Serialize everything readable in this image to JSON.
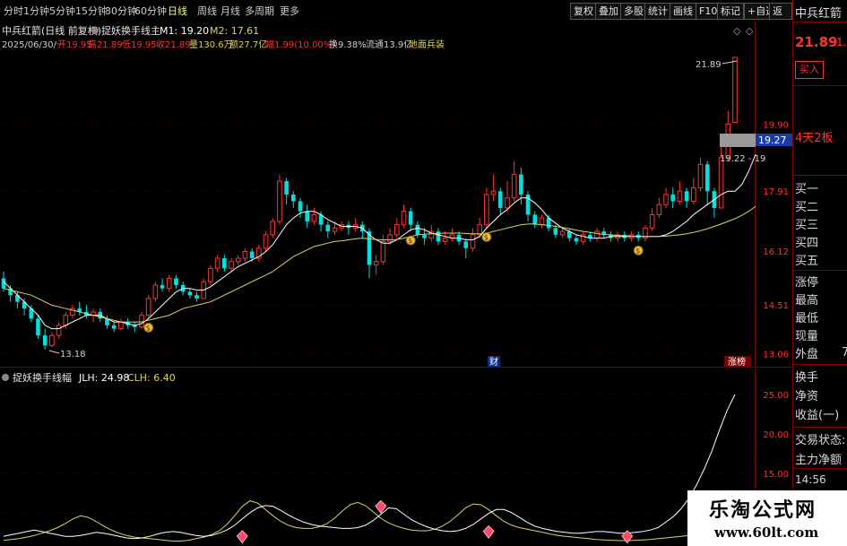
{
  "toolbar": {
    "periods": [
      "分时",
      "1分钟",
      "5分钟",
      "15分钟",
      "30分钟",
      "60分钟",
      "日线",
      "周线",
      "月线",
      "多周期",
      "更多"
    ],
    "active_period": "日线",
    "buttons": [
      "复权",
      "叠加",
      "多股",
      "统计",
      "画线",
      "F10",
      "标记",
      "+自选",
      "返回"
    ]
  },
  "chart_header": {
    "stock_title": "中兵红箭(日线 前复权)",
    "indicator_name": "捉妖换手线主",
    "m1": "M1: 19.20",
    "m2": "M2: 17.61",
    "date": "2025/06/30/一",
    "open": "开19.95",
    "high": "高21.89",
    "low": "低19.95",
    "close": "收21.89",
    "volume": "量130.6万",
    "amount": "额27.7亿",
    "change": "幅1.99(10.00%)",
    "turnover": "换9.38%",
    "float_value": "流通13.9亿",
    "concept": "地面兵装"
  },
  "price_axis": {
    "labels": [
      "19.90",
      "17.91",
      "16.12",
      "14.51",
      "13.06"
    ],
    "current_price_tag": "19.27",
    "max_label": "21.89",
    "min_label": "13.18",
    "range_label": "19.22 - 19"
  },
  "markers": {
    "finance": "财",
    "limit_list": "涨榜"
  },
  "indicator": {
    "title": "捉妖换手线幅",
    "jlh": "JLH: 24.98",
    "clh": "CLH: 6.40",
    "axis_labels": [
      "25.00",
      "20.00",
      "15.00",
      "10.00"
    ]
  },
  "right_panel": {
    "stock_name": "中兵红箭",
    "price": "21.89",
    "price_extra": "1.9",
    "buy_button": "买入",
    "board_status": "4天2板",
    "bid_levels": [
      "买一",
      "买二",
      "买三",
      "买四",
      "买五"
    ],
    "stats": [
      "涨停",
      "最高",
      "最低",
      "现量",
      "外盘"
    ],
    "outer_value": "7",
    "rows": [
      "换手",
      "净资",
      "收益(一)"
    ],
    "trade_status": "交易状态:",
    "main_flow": "主力净额",
    "time": "14:56"
  },
  "watermark": {
    "title": "乐淘公式网",
    "url": "www.60lt.com"
  },
  "colors": {
    "up": "#ff3232",
    "down": "#00e0e0",
    "ma_fast": "#ffffff",
    "ma_slow": "#e0d060",
    "frame": "#7a0000",
    "panel_text": "#d8d8d8"
  },
  "chart_data": {
    "type": "candlestick",
    "candles": [
      {
        "o": 15.3,
        "c": 15.0,
        "h": 15.5,
        "l": 14.9
      },
      {
        "o": 15.0,
        "c": 14.8,
        "h": 15.1,
        "l": 14.6
      },
      {
        "o": 14.8,
        "c": 14.6,
        "h": 14.9,
        "l": 14.4
      },
      {
        "o": 14.6,
        "c": 14.4,
        "h": 14.7,
        "l": 14.2
      },
      {
        "o": 14.4,
        "c": 14.1,
        "h": 14.5,
        "l": 14.0
      },
      {
        "o": 14.1,
        "c": 13.6,
        "h": 14.2,
        "l": 13.5
      },
      {
        "o": 13.6,
        "c": 13.3,
        "h": 13.8,
        "l": 13.18
      },
      {
        "o": 13.3,
        "c": 13.6,
        "h": 13.7,
        "l": 13.25
      },
      {
        "o": 13.6,
        "c": 13.9,
        "h": 14.0,
        "l": 13.5
      },
      {
        "o": 13.9,
        "c": 14.2,
        "h": 14.3,
        "l": 13.8
      },
      {
        "o": 14.2,
        "c": 14.4,
        "h": 14.5,
        "l": 14.1
      },
      {
        "o": 14.4,
        "c": 14.3,
        "h": 14.6,
        "l": 14.2
      },
      {
        "o": 14.3,
        "c": 14.2,
        "h": 14.5,
        "l": 14.1
      },
      {
        "o": 14.2,
        "c": 14.3,
        "h": 14.4,
        "l": 14.0
      },
      {
        "o": 14.3,
        "c": 14.1,
        "h": 14.4,
        "l": 14.0
      },
      {
        "o": 14.1,
        "c": 13.9,
        "h": 14.2,
        "l": 13.8
      },
      {
        "o": 13.9,
        "c": 13.8,
        "h": 14.0,
        "l": 13.7
      },
      {
        "o": 13.8,
        "c": 14.0,
        "h": 14.1,
        "l": 13.75
      },
      {
        "o": 14.0,
        "c": 13.9,
        "h": 14.1,
        "l": 13.8
      },
      {
        "o": 13.9,
        "c": 13.85,
        "h": 14.0,
        "l": 13.7
      },
      {
        "o": 13.85,
        "c": 14.2,
        "h": 14.3,
        "l": 13.8
      },
      {
        "o": 14.2,
        "c": 14.7,
        "h": 14.8,
        "l": 14.1
      },
      {
        "o": 14.7,
        "c": 15.1,
        "h": 15.2,
        "l": 14.6
      },
      {
        "o": 15.1,
        "c": 15.0,
        "h": 15.3,
        "l": 14.9
      },
      {
        "o": 15.0,
        "c": 15.3,
        "h": 15.4,
        "l": 14.9
      },
      {
        "o": 15.3,
        "c": 15.1,
        "h": 15.4,
        "l": 15.0
      },
      {
        "o": 15.1,
        "c": 14.9,
        "h": 15.2,
        "l": 14.8
      },
      {
        "o": 14.9,
        "c": 14.8,
        "h": 15.0,
        "l": 14.7
      },
      {
        "o": 14.8,
        "c": 14.7,
        "h": 14.9,
        "l": 14.6
      },
      {
        "o": 14.7,
        "c": 15.2,
        "h": 15.3,
        "l": 14.7
      },
      {
        "o": 15.2,
        "c": 15.6,
        "h": 15.7,
        "l": 15.1
      },
      {
        "o": 15.6,
        "c": 15.9,
        "h": 16.0,
        "l": 15.5
      },
      {
        "o": 15.9,
        "c": 15.6,
        "h": 16.0,
        "l": 15.5
      },
      {
        "o": 15.6,
        "c": 15.8,
        "h": 15.9,
        "l": 15.5
      },
      {
        "o": 15.8,
        "c": 15.9,
        "h": 16.0,
        "l": 15.7
      },
      {
        "o": 15.9,
        "c": 16.1,
        "h": 16.2,
        "l": 15.8
      },
      {
        "o": 16.1,
        "c": 15.9,
        "h": 16.2,
        "l": 15.8
      },
      {
        "o": 15.9,
        "c": 16.2,
        "h": 16.3,
        "l": 15.8
      },
      {
        "o": 16.2,
        "c": 16.6,
        "h": 16.7,
        "l": 16.1
      },
      {
        "o": 16.6,
        "c": 17.0,
        "h": 17.1,
        "l": 16.5
      },
      {
        "o": 17.0,
        "c": 18.2,
        "h": 18.4,
        "l": 16.9
      },
      {
        "o": 18.2,
        "c": 17.8,
        "h": 18.3,
        "l": 17.5
      },
      {
        "o": 17.8,
        "c": 17.6,
        "h": 17.9,
        "l": 17.4
      },
      {
        "o": 17.6,
        "c": 17.3,
        "h": 17.7,
        "l": 17.1
      },
      {
        "o": 17.3,
        "c": 17.0,
        "h": 17.5,
        "l": 16.8
      },
      {
        "o": 17.0,
        "c": 17.2,
        "h": 17.4,
        "l": 16.9
      },
      {
        "o": 17.2,
        "c": 16.9,
        "h": 17.3,
        "l": 16.7
      },
      {
        "o": 16.9,
        "c": 16.7,
        "h": 17.0,
        "l": 16.5
      },
      {
        "o": 16.7,
        "c": 16.8,
        "h": 17.0,
        "l": 16.6
      },
      {
        "o": 16.8,
        "c": 16.9,
        "h": 17.0,
        "l": 16.7
      },
      {
        "o": 16.9,
        "c": 16.8,
        "h": 17.0,
        "l": 16.6
      },
      {
        "o": 16.8,
        "c": 16.9,
        "h": 17.1,
        "l": 16.7
      },
      {
        "o": 16.9,
        "c": 16.7,
        "h": 17.0,
        "l": 16.5
      },
      {
        "o": 16.7,
        "c": 15.7,
        "h": 16.8,
        "l": 15.3
      },
      {
        "o": 15.7,
        "c": 15.8,
        "h": 16.0,
        "l": 15.4
      },
      {
        "o": 15.8,
        "c": 16.4,
        "h": 16.6,
        "l": 15.7
      },
      {
        "o": 16.4,
        "c": 16.6,
        "h": 16.8,
        "l": 16.3
      },
      {
        "o": 16.6,
        "c": 16.9,
        "h": 17.1,
        "l": 16.5
      },
      {
        "o": 16.9,
        "c": 17.3,
        "h": 17.5,
        "l": 16.8
      },
      {
        "o": 17.3,
        "c": 16.9,
        "h": 17.4,
        "l": 16.7
      },
      {
        "o": 16.9,
        "c": 16.6,
        "h": 17.0,
        "l": 16.5
      },
      {
        "o": 16.6,
        "c": 16.5,
        "h": 16.8,
        "l": 16.3
      },
      {
        "o": 16.5,
        "c": 16.7,
        "h": 16.9,
        "l": 16.4
      },
      {
        "o": 16.7,
        "c": 16.4,
        "h": 16.8,
        "l": 16.3
      },
      {
        "o": 16.4,
        "c": 16.5,
        "h": 16.7,
        "l": 16.3
      },
      {
        "o": 16.5,
        "c": 16.6,
        "h": 16.8,
        "l": 16.4
      },
      {
        "o": 16.6,
        "c": 16.4,
        "h": 16.7,
        "l": 16.3
      },
      {
        "o": 16.4,
        "c": 16.2,
        "h": 16.5,
        "l": 15.9
      },
      {
        "o": 16.2,
        "c": 16.6,
        "h": 16.8,
        "l": 16.1
      },
      {
        "o": 16.6,
        "c": 16.9,
        "h": 17.1,
        "l": 16.5
      },
      {
        "o": 16.9,
        "c": 17.8,
        "h": 18.0,
        "l": 16.8
      },
      {
        "o": 17.8,
        "c": 17.9,
        "h": 18.4,
        "l": 17.6
      },
      {
        "o": 17.9,
        "c": 17.4,
        "h": 18.0,
        "l": 17.2
      },
      {
        "o": 17.4,
        "c": 17.7,
        "h": 18.2,
        "l": 17.3
      },
      {
        "o": 17.7,
        "c": 18.4,
        "h": 18.8,
        "l": 17.6
      },
      {
        "o": 18.4,
        "c": 17.8,
        "h": 18.6,
        "l": 17.5
      },
      {
        "o": 17.8,
        "c": 17.2,
        "h": 17.9,
        "l": 17.0
      },
      {
        "o": 17.2,
        "c": 16.9,
        "h": 17.3,
        "l": 16.8
      },
      {
        "o": 16.9,
        "c": 17.1,
        "h": 17.2,
        "l": 16.8
      },
      {
        "o": 17.1,
        "c": 16.8,
        "h": 17.2,
        "l": 16.7
      },
      {
        "o": 16.8,
        "c": 16.6,
        "h": 16.9,
        "l": 16.5
      },
      {
        "o": 16.6,
        "c": 16.7,
        "h": 16.8,
        "l": 16.5
      },
      {
        "o": 16.7,
        "c": 16.5,
        "h": 16.8,
        "l": 16.4
      },
      {
        "o": 16.5,
        "c": 16.4,
        "h": 16.6,
        "l": 16.3
      },
      {
        "o": 16.4,
        "c": 16.6,
        "h": 16.7,
        "l": 16.3
      },
      {
        "o": 16.6,
        "c": 16.5,
        "h": 16.7,
        "l": 16.4
      },
      {
        "o": 16.5,
        "c": 16.7,
        "h": 16.8,
        "l": 16.4
      },
      {
        "o": 16.7,
        "c": 16.6,
        "h": 16.8,
        "l": 16.5
      },
      {
        "o": 16.6,
        "c": 16.5,
        "h": 16.7,
        "l": 16.4
      },
      {
        "o": 16.5,
        "c": 16.6,
        "h": 16.7,
        "l": 16.4
      },
      {
        "o": 16.6,
        "c": 16.5,
        "h": 16.7,
        "l": 16.4
      },
      {
        "o": 16.5,
        "c": 16.6,
        "h": 16.7,
        "l": 16.4
      },
      {
        "o": 16.6,
        "c": 16.5,
        "h": 16.7,
        "l": 16.4
      },
      {
        "o": 16.5,
        "c": 16.8,
        "h": 16.9,
        "l": 16.4
      },
      {
        "o": 16.8,
        "c": 17.2,
        "h": 17.4,
        "l": 16.7
      },
      {
        "o": 17.2,
        "c": 17.5,
        "h": 17.7,
        "l": 17.1
      },
      {
        "o": 17.5,
        "c": 17.8,
        "h": 18.0,
        "l": 17.4
      },
      {
        "o": 17.8,
        "c": 17.6,
        "h": 18.0,
        "l": 17.4
      },
      {
        "o": 17.6,
        "c": 17.9,
        "h": 18.2,
        "l": 17.5
      },
      {
        "o": 17.9,
        "c": 17.6,
        "h": 18.0,
        "l": 17.4
      },
      {
        "o": 17.6,
        "c": 18.0,
        "h": 18.3,
        "l": 17.5
      },
      {
        "o": 18.0,
        "c": 18.7,
        "h": 18.9,
        "l": 17.9
      },
      {
        "o": 18.7,
        "c": 17.9,
        "h": 18.8,
        "l": 17.5
      },
      {
        "o": 17.9,
        "c": 17.4,
        "h": 18.0,
        "l": 17.1
      },
      {
        "o": 17.4,
        "c": 18.9,
        "h": 19.3,
        "l": 17.4
      },
      {
        "o": 18.9,
        "c": 19.9,
        "h": 20.3,
        "l": 18.8
      },
      {
        "o": 19.95,
        "c": 21.89,
        "h": 21.89,
        "l": 19.95
      }
    ],
    "ma_fast": [
      15.2,
      15.0,
      14.8,
      14.6,
      14.4,
      14.2,
      13.9,
      13.8,
      13.8,
      13.9,
      14.0,
      14.1,
      14.2,
      14.2,
      14.2,
      14.1,
      14.0,
      14.0,
      13.95,
      13.9,
      13.95,
      14.1,
      14.3,
      14.5,
      14.7,
      14.9,
      15.0,
      15.0,
      14.95,
      14.95,
      15.05,
      15.2,
      15.35,
      15.5,
      15.65,
      15.75,
      15.85,
      15.95,
      16.1,
      16.3,
      16.6,
      16.9,
      17.1,
      17.25,
      17.3,
      17.3,
      17.2,
      17.05,
      16.95,
      16.85,
      16.85,
      16.85,
      16.8,
      16.6,
      16.45,
      16.35,
      16.35,
      16.45,
      16.6,
      16.75,
      16.8,
      16.75,
      16.65,
      16.6,
      16.55,
      16.5,
      16.5,
      16.45,
      16.45,
      16.55,
      16.8,
      17.0,
      17.2,
      17.35,
      17.55,
      17.7,
      17.7,
      17.55,
      17.35,
      17.1,
      16.95,
      16.8,
      16.7,
      16.6,
      16.55,
      16.5,
      16.5,
      16.5,
      16.55,
      16.55,
      16.55,
      16.55,
      16.55,
      16.55,
      16.55,
      16.55,
      16.6,
      16.7,
      16.85,
      17.0,
      17.2,
      17.35,
      17.5,
      17.65,
      17.8,
      17.9,
      17.9,
      18.1,
      18.5,
      19.0
    ],
    "ma_slow": [
      15.0,
      14.95,
      14.9,
      14.85,
      14.8,
      14.7,
      14.6,
      14.5,
      14.45,
      14.4,
      14.35,
      14.3,
      14.25,
      14.2,
      14.15,
      14.1,
      14.05,
      14.0,
      14.0,
      14.0,
      14.0,
      14.05,
      14.1,
      14.15,
      14.2,
      14.3,
      14.4,
      14.45,
      14.5,
      14.55,
      14.6,
      14.7,
      14.8,
      14.9,
      15.0,
      15.1,
      15.2,
      15.3,
      15.4,
      15.5,
      15.65,
      15.8,
      15.95,
      16.05,
      16.15,
      16.25,
      16.3,
      16.35,
      16.4,
      16.42,
      16.45,
      16.48,
      16.5,
      16.48,
      16.46,
      16.45,
      16.45,
      16.46,
      16.5,
      16.55,
      16.6,
      16.62,
      16.63,
      16.64,
      16.65,
      16.65,
      16.65,
      16.64,
      16.63,
      16.63,
      16.65,
      16.7,
      16.75,
      16.8,
      16.85,
      16.9,
      16.92,
      16.92,
      16.9,
      16.88,
      16.85,
      16.82,
      16.78,
      16.74,
      16.7,
      16.67,
      16.64,
      16.61,
      16.6,
      16.58,
      16.57,
      16.56,
      16.55,
      16.55,
      16.55,
      16.55,
      16.56,
      16.58,
      16.6,
      16.63,
      16.67,
      16.72,
      16.78,
      16.85,
      16.92,
      17.0,
      17.08,
      17.18,
      17.3,
      17.45
    ],
    "signal_indices": [
      21,
      59,
      70,
      92
    ],
    "jlh": [
      7.0,
      7.2,
      7.4,
      7.6,
      7.8,
      7.6,
      7.4,
      7.2,
      7.0,
      7.0,
      7.1,
      7.3,
      7.5,
      7.4,
      7.2,
      7.0,
      6.8,
      6.7,
      6.8,
      7.0,
      7.3,
      7.5,
      7.6,
      7.5,
      7.3,
      7.1,
      7.0,
      7.1,
      7.4,
      7.8,
      8.4,
      9.2,
      10.0,
      10.6,
      10.9,
      10.8,
      10.3,
      9.7,
      9.2,
      8.8,
      8.5,
      8.3,
      8.2,
      8.1,
      8.0,
      8.0,
      8.1,
      8.4,
      9.0,
      9.8,
      10.6,
      10.5,
      9.8,
      9.1,
      8.6,
      8.2,
      7.9,
      7.7,
      7.6,
      7.7,
      8.0,
      8.5,
      9.2,
      9.9,
      10.4,
      10.4,
      10.0,
      9.4,
      8.8,
      8.3,
      8.0,
      7.8,
      7.6,
      7.5,
      7.4,
      7.4,
      7.5,
      7.6,
      7.6,
      7.5,
      7.4,
      7.4,
      7.5,
      7.6,
      7.8,
      8.1,
      8.8,
      9.5,
      10.5,
      11.8,
      13.5,
      15.5,
      17.8,
      20.5,
      23.0,
      24.98
    ],
    "clh": [
      6.5,
      6.6,
      6.7,
      6.9,
      7.1,
      7.4,
      7.7,
      8.1,
      8.6,
      9.2,
      9.6,
      9.4,
      8.9,
      8.3,
      7.8,
      7.4,
      7.1,
      6.9,
      6.8,
      6.7,
      6.6,
      6.5,
      6.4,
      6.4,
      6.5,
      6.7,
      6.9,
      7.2,
      7.7,
      8.5,
      9.6,
      10.8,
      11.5,
      11.2,
      10.4,
      9.6,
      8.9,
      8.4,
      8.1,
      8.0,
      8.0,
      8.2,
      8.6,
      9.3,
      10.2,
      11.0,
      11.3,
      10.9,
      10.1,
      9.3,
      8.7,
      8.3,
      8.0,
      7.8,
      7.7,
      7.7,
      7.9,
      8.3,
      8.9,
      9.7,
      10.6,
      11.1,
      11.0,
      10.4,
      9.6,
      8.9,
      8.4,
      8.1,
      7.9,
      7.7,
      7.5,
      7.3,
      7.1,
      7.0,
      6.9,
      6.8,
      6.7,
      6.6,
      6.55,
      6.5,
      6.45,
      6.45,
      6.5,
      6.55,
      6.6,
      6.7,
      6.8,
      6.9,
      7.0,
      7.1,
      7.3,
      7.5,
      7.8,
      8.2,
      9.0,
      6.4
    ],
    "ylim": [
      12.8,
      21.89
    ],
    "ind_ylim": [
      6,
      26
    ]
  }
}
